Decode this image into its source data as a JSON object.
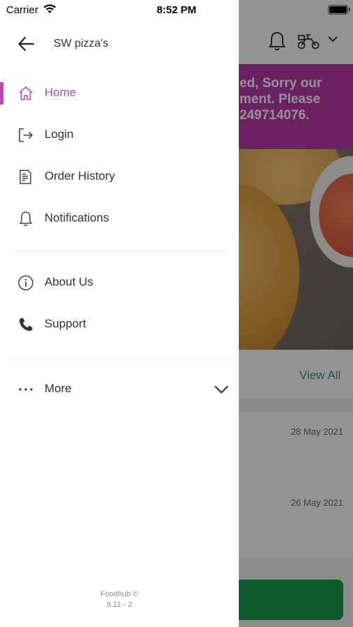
{
  "status_bar": {
    "carrier": "Carrier",
    "time": "8:52 PM"
  },
  "drawer": {
    "store_name": "SW pizza's",
    "menu_primary": [
      {
        "label": "Home",
        "icon": "home-icon",
        "active": true
      },
      {
        "label": "Login",
        "icon": "login-icon",
        "active": false
      },
      {
        "label": "Order History",
        "icon": "receipt-icon",
        "active": false
      },
      {
        "label": "Notifications",
        "icon": "bell-icon",
        "active": false
      }
    ],
    "menu_secondary": [
      {
        "label": "About Us",
        "icon": "info-icon"
      },
      {
        "label": "Support",
        "icon": "phone-icon"
      }
    ],
    "more_label": "More",
    "footer": {
      "brand": "Foodhub ©",
      "version": "9.11 - 2"
    }
  },
  "background_app": {
    "banner_lines": [
      "ed, Sorry our",
      "ment. Please",
      "249714076."
    ],
    "view_all": "View All",
    "order_dates": [
      "28 May 2021",
      "26 May 2021"
    ]
  },
  "colors": {
    "accent": "#b64bad",
    "banner": "#b73aa9",
    "link": "#2b8fa7",
    "button_green": "#1b9c4b"
  }
}
